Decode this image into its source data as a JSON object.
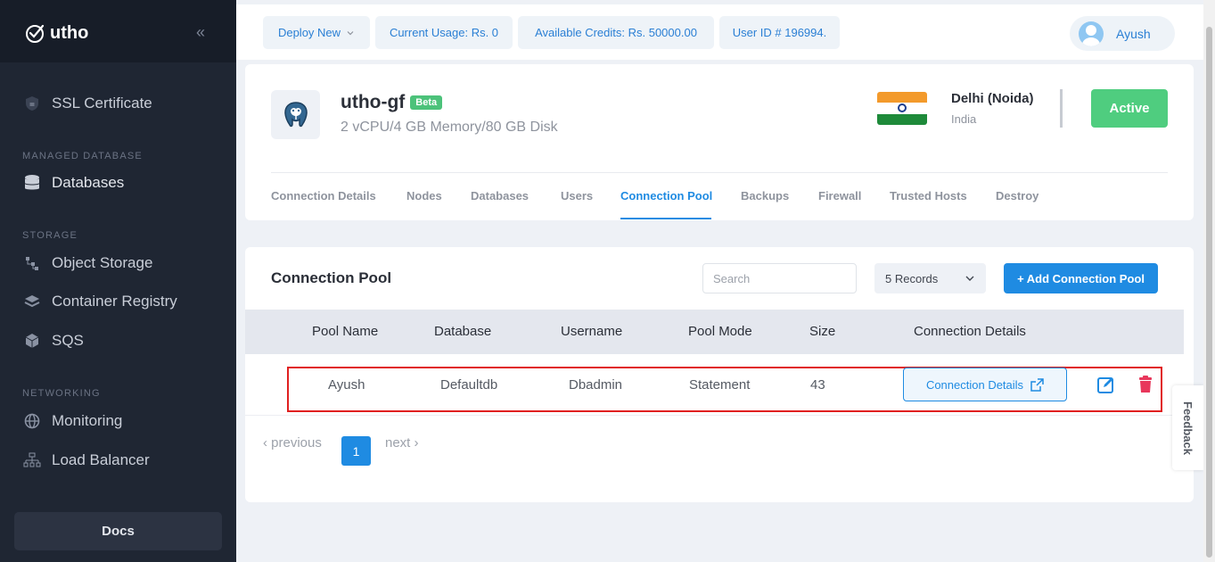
{
  "sidebar": {
    "brand": "utho",
    "items": {
      "ssl": "SSL Certificate",
      "databases": "Databases",
      "object_storage": "Object Storage",
      "container_registry": "Container Registry",
      "sqs": "SQS",
      "monitoring": "Monitoring",
      "load_balancer": "Load Balancer"
    },
    "sections": {
      "managed_database": "MANAGED DATABASE",
      "storage": "STORAGE",
      "networking": "NETWORKING"
    },
    "docs_label": "Docs"
  },
  "topbar": {
    "deploy_new": "Deploy New",
    "current_usage": "Current Usage: Rs. 0",
    "available_credits": "Available Credits: Rs. 50000.00",
    "user_id": "User ID # 196994.",
    "user_name": "Ayush"
  },
  "header": {
    "db_name": "utho-gf",
    "badge": "Beta",
    "spec": "2 vCPU/4 GB Memory/80 GB Disk",
    "region": "Delhi (Noida)",
    "country": "India",
    "status": "Active"
  },
  "tabs": [
    "Connection Details",
    "Nodes",
    "Databases",
    "Users",
    "Connection Pool",
    "Backups",
    "Firewall",
    "Trusted Hosts",
    "Destroy"
  ],
  "pool": {
    "title": "Connection Pool",
    "search_placeholder": "Search",
    "records": "5 Records",
    "add_label": "+ Add Connection Pool",
    "columns": [
      "Pool Name",
      "Database",
      "Username",
      "Pool Mode",
      "Size",
      "Connection Details"
    ],
    "rows": [
      {
        "pool_name": "Ayush",
        "database": "Defaultdb",
        "username": "Dbadmin",
        "pool_mode": "Statement",
        "size": "43",
        "details_label": "Connection Details"
      }
    ],
    "pager": {
      "previous": "‹ previous",
      "page": "1",
      "next": "next ›"
    }
  },
  "feedback_label": "Feedback",
  "colors": {
    "accent": "#1f8be2",
    "active": "#4fcd7f",
    "sidebar": "#1f2633",
    "highlight": "#e02020",
    "danger": "#e8375b"
  }
}
